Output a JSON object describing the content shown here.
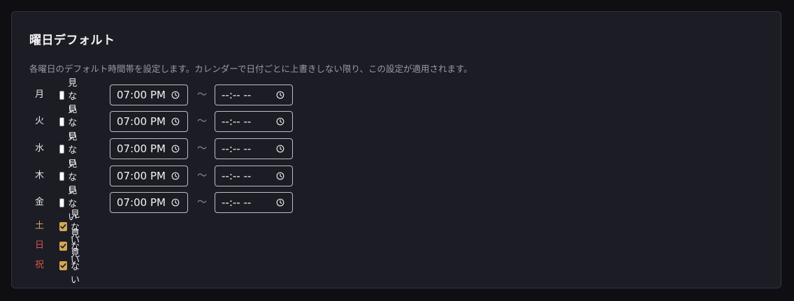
{
  "section": {
    "title": "曜日デフォルト",
    "description": "各曜日のデフォルト時間帯を設定します。カレンダーで日付ごとに上書きしない限り、この設定が適用されます。"
  },
  "hide_label": "見ない",
  "range_separator": "〜",
  "weekdays": [
    {
      "day": "月",
      "hidden": false,
      "start": "07:00 PM",
      "end": "--:-- --"
    },
    {
      "day": "火",
      "hidden": false,
      "start": "07:00 PM",
      "end": "--:-- --"
    },
    {
      "day": "水",
      "hidden": false,
      "start": "07:00 PM",
      "end": "--:-- --"
    },
    {
      "day": "木",
      "hidden": false,
      "start": "07:00 PM",
      "end": "--:-- --"
    },
    {
      "day": "金",
      "hidden": false,
      "start": "07:00 PM",
      "end": "--:-- --"
    }
  ],
  "special_days": [
    {
      "day": "土",
      "hidden": true
    },
    {
      "day": "日",
      "hidden": true
    },
    {
      "day": "祝",
      "hidden": true
    }
  ],
  "colors": {
    "saturday": "#d4a853",
    "sunday": "#d9534f",
    "holiday": "#d9534f",
    "checkbox_checked": "#d4a853"
  }
}
